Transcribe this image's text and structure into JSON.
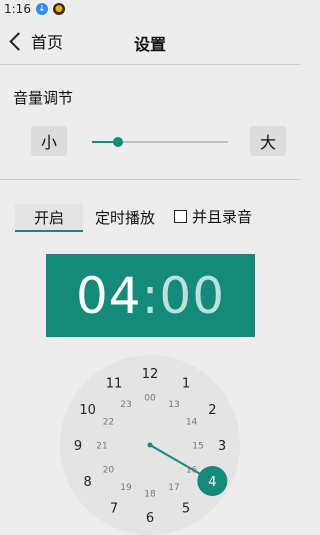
{
  "status_bar": {
    "time": "1:16"
  },
  "header": {
    "back_label": "首页",
    "title": "设置"
  },
  "volume": {
    "label": "音量调节",
    "min_label": "小",
    "max_label": "大",
    "level": 0.19
  },
  "options": {
    "toggle_label": "开启",
    "timer_label": "定时播放",
    "record_label": "并且录音",
    "record_checked": false
  },
  "time_display": {
    "hours": "04",
    "separator": ":",
    "minutes": "00"
  },
  "clock": {
    "outer": [
      "12",
      "1",
      "2",
      "3",
      "4",
      "5",
      "6",
      "7",
      "8",
      "9",
      "10",
      "11"
    ],
    "inner": [
      "00",
      "13",
      "14",
      "15",
      "16",
      "17",
      "18",
      "19",
      "20",
      "21",
      "22",
      "23"
    ],
    "selected": "4"
  },
  "colors": {
    "accent": "#138a7a",
    "background": "#ededed",
    "clock_face": "#e4e4e4"
  }
}
